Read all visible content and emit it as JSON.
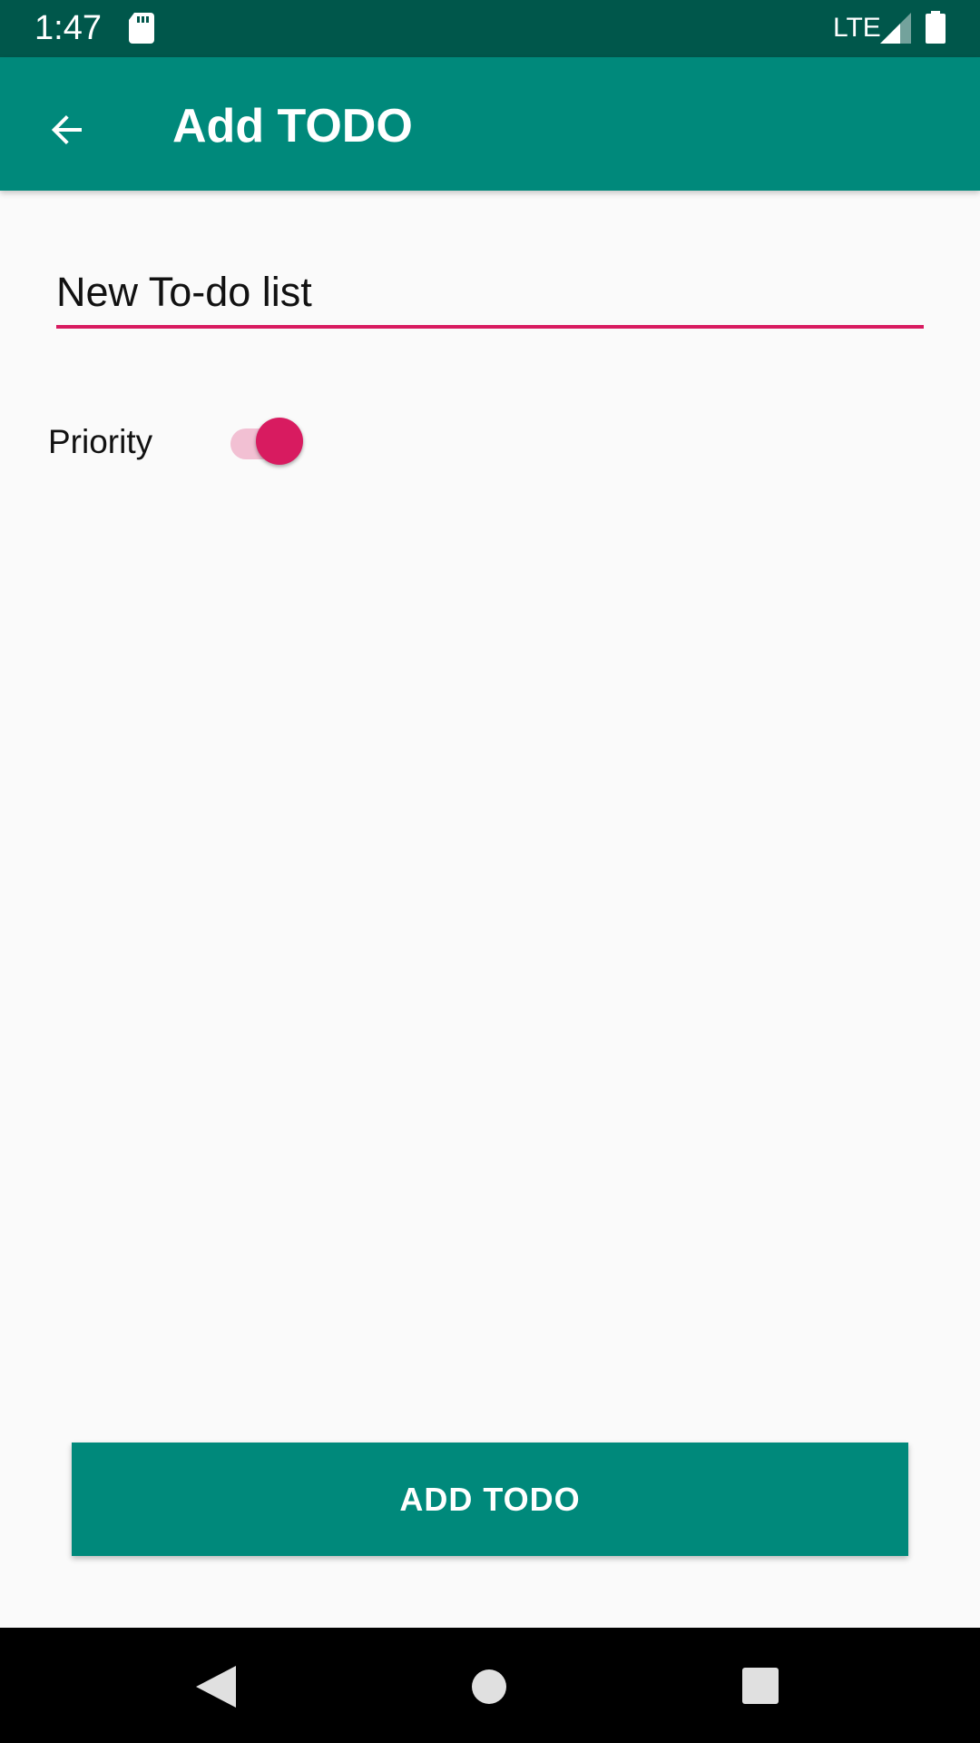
{
  "status_bar": {
    "time": "1:47",
    "network": "LTE",
    "icons": [
      "sd-card-icon",
      "signal-icon",
      "battery-icon"
    ]
  },
  "app_bar": {
    "title": "Add TODO",
    "back_icon": "arrow-back-icon",
    "color": "#00897b"
  },
  "form": {
    "title_value": "New To-do list",
    "priority_label": "Priority",
    "priority_enabled": true,
    "accent_color": "#d81b60"
  },
  "submit_button": {
    "label": "ADD TODO",
    "color": "#00897b"
  },
  "nav_bar": {
    "icons": [
      "nav-back-icon",
      "nav-home-icon",
      "nav-recents-icon"
    ]
  }
}
